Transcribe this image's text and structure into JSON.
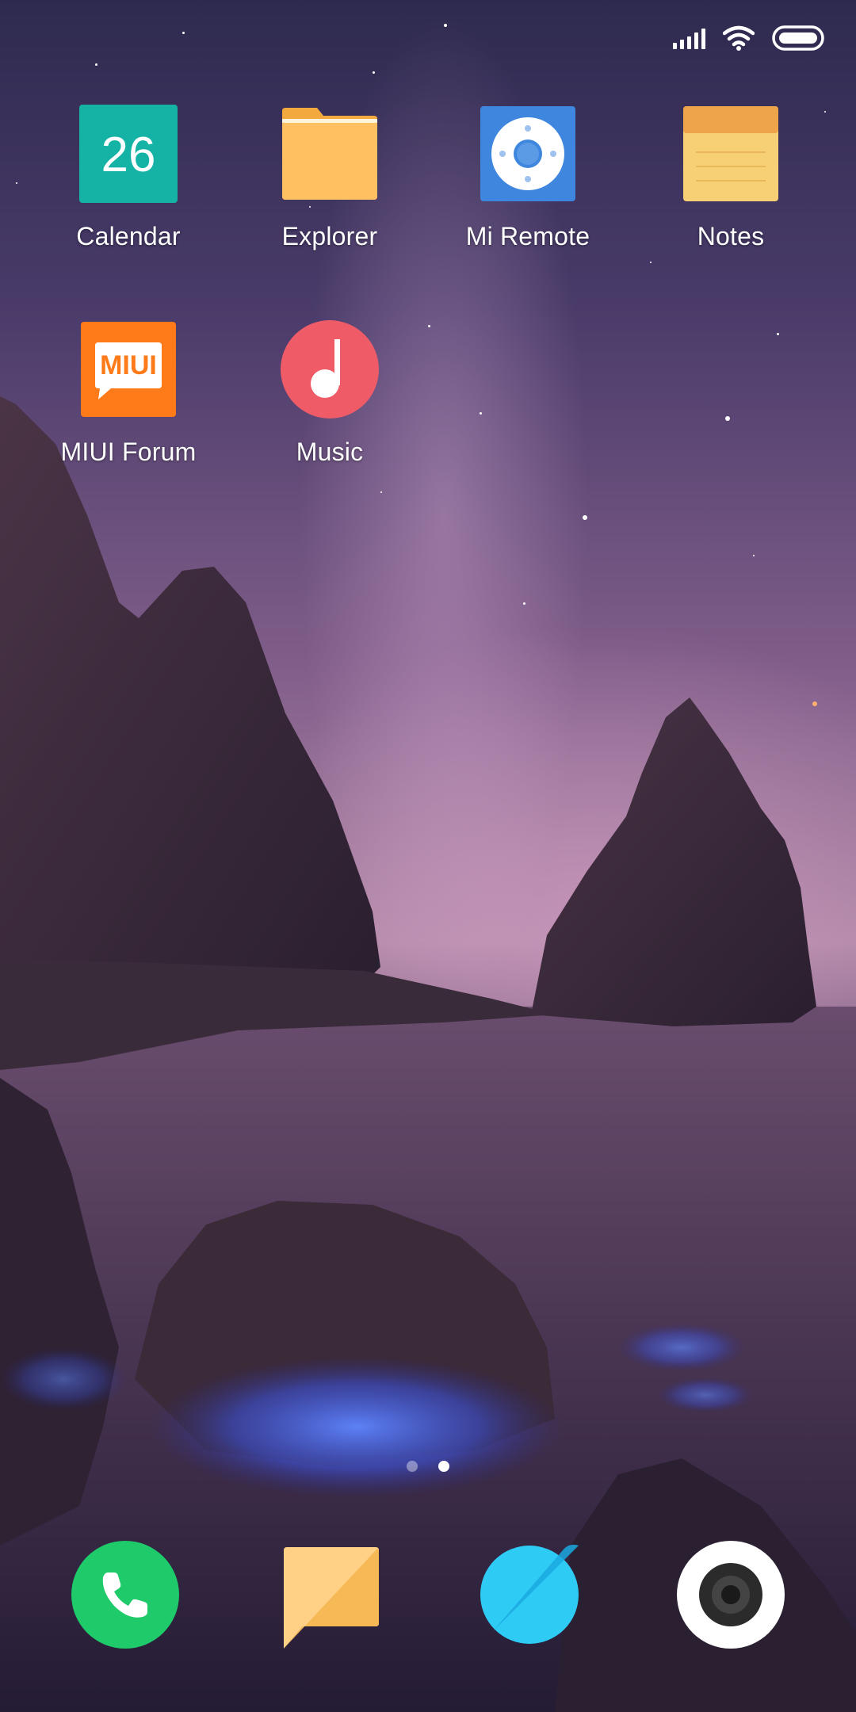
{
  "status_bar": {
    "signal_icon": "signal-bars-icon",
    "wifi_icon": "wifi-icon",
    "battery_icon": "battery-icon"
  },
  "apps": [
    {
      "label": "Calendar",
      "icon": "calendar-icon",
      "icon_text": "26"
    },
    {
      "label": "Explorer",
      "icon": "folder-icon"
    },
    {
      "label": "Mi Remote",
      "icon": "remote-icon"
    },
    {
      "label": "Notes",
      "icon": "notes-icon"
    },
    {
      "label": "MIUI Forum",
      "icon": "miui-forum-icon",
      "icon_text": "MIUI"
    },
    {
      "label": "Music",
      "icon": "music-note-icon"
    }
  ],
  "page_indicator": {
    "pages": 2,
    "current": 2
  },
  "dock": [
    {
      "icon": "phone-icon"
    },
    {
      "icon": "messages-icon"
    },
    {
      "icon": "browser-icon"
    },
    {
      "icon": "camera-icon"
    }
  ],
  "colors": {
    "calendar": "#14b3a5",
    "folder": "#ffc062",
    "remote": "#3f86de",
    "notes": "#f7cf74",
    "miui": "#ff7a18",
    "music": "#ef5c67",
    "phone": "#1fca6a",
    "messages": "#ffc973",
    "browser": "#2ecbf5"
  }
}
